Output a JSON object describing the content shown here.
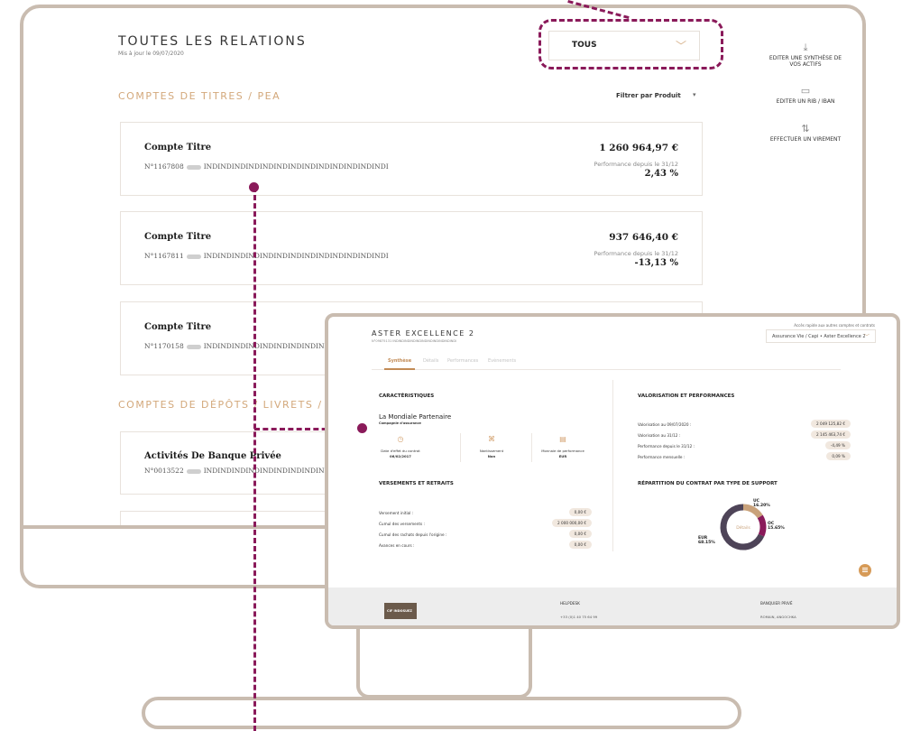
{
  "main": {
    "title": "TOUTES LES RELATIONS",
    "subtitle": "Mis à jour le 09/07/2020",
    "dropdown_value": "TOUS",
    "section_titres": "COMPTES DE TITRES / PEA",
    "section_depots": "COMPTES DE DÉPÔTS / LIVRETS /",
    "filter_label": "Filtrer par Produit",
    "actions": [
      {
        "label": "EDITER UNE SYNTHÈSE DE VOS ACTIFS",
        "icon": "download-icon"
      },
      {
        "label": "EDITER UN RIB / IBAN",
        "icon": "document-icon"
      },
      {
        "label": "EFFECTUER UN VIREMENT",
        "icon": "transfer-icon"
      }
    ],
    "cards": [
      {
        "name": "Compte Titre",
        "num_prefix": "N°1167808",
        "num_suffix": "INDINDINDINDINDINDINDINDINDINDINDINDINDI",
        "amount": "1 260 964,97 €",
        "perf_label": "Performance depuis le 31/12",
        "perf": "2,43 %"
      },
      {
        "name": "Compte Titre",
        "num_prefix": "N°1167811",
        "num_suffix": "INDINDINDINDINDINDINDINDINDINDINDINDINDI",
        "amount": "937 646,40 €",
        "perf_label": "Performance depuis le 31/12",
        "perf": "-13,13 %"
      },
      {
        "name": "Compte Titre",
        "num_prefix": "N°1170158",
        "num_suffix": "INDINDINDINDINDINDINDINDINDINDINDI"
      }
    ],
    "depot_card": {
      "name": "Activités De Banque Privée",
      "num_prefix": "N°0013522",
      "num_suffix": "INDINDINDINDINDINDINDINDINDINDINDI"
    }
  },
  "laptop": {
    "title": "ASTER EXCELLENCE 2",
    "subtitle": "N°09875131 INDINDINDINDINDINDINDINDINDINDINDI",
    "quick_access": "Accès rapide aux autres comptes et contrats",
    "select_value": "Assurance Vie / Capi • Aster Excellence 2",
    "tabs": [
      "Synthèse",
      "Détails",
      "Performances",
      "Evènements"
    ],
    "caract_title": "CARACTÉRISTIQUES",
    "company": "La Mondiale Partenaire",
    "company_sub": "Compagnie d'assurance",
    "kpis": [
      {
        "label": "Date d'effet du contrat",
        "value": "06/02/2017",
        "icon": "clock-icon"
      },
      {
        "label": "Nantissement",
        "value": "Non",
        "icon": "link-icon"
      },
      {
        "label": "Monnaie de performance",
        "value": "EUR",
        "icon": "bill-icon"
      }
    ],
    "valor_title": "VALORISATION ET PERFORMANCES",
    "valor_rows": [
      {
        "label": "Valorisation au 09/07/2020 :",
        "value": "2 049 125,82 €"
      },
      {
        "label": "Valorisation au 31/12 :",
        "value": "2 145 463,74 €"
      },
      {
        "label": "Performance depuis le 31/12 :",
        "value": "-4,49 %"
      },
      {
        "label": "Performance mensuelle :",
        "value": "0,09 %"
      }
    ],
    "vers_title": "VERSEMENTS ET RETRAITS",
    "vers_rows": [
      {
        "label": "Versement initial :",
        "value": "0,00 €"
      },
      {
        "label": "Cumul des versements :",
        "value": "2 000 000,00 €"
      },
      {
        "label": "Cumul des rachats depuis l'origine :",
        "value": "0,00 €"
      },
      {
        "label": "Avances en cours :",
        "value": "0,00 €"
      }
    ],
    "repart_title": "RÉPARTITION DU CONTRAT PAR TYPE DE SUPPORT",
    "donut_center": "Détails",
    "donut": [
      {
        "name": "UC",
        "value": "16.20%",
        "frac": 0.162,
        "color": "#c9a27b"
      },
      {
        "name": "OC",
        "value": "15.65%",
        "frac": 0.1565,
        "color": "#8a1a5a"
      },
      {
        "name": "EUR",
        "value": "68.15%",
        "frac": 0.6815,
        "color": "#4e4458"
      }
    ],
    "footer": {
      "logo": "CIF INDOSUEZ",
      "helpdesk_title": "HELPDESK",
      "helpdesk_phone": "+33 (0)1 40 75 64 99",
      "banquier_title": "BANQUIER PRIVÉ",
      "banquier_name": "ROMAIN, ANGOCHKA"
    }
  },
  "colors": {
    "accent": "#d3a87b",
    "connector": "#8a1a5a",
    "frame": "#c9bcb0"
  }
}
